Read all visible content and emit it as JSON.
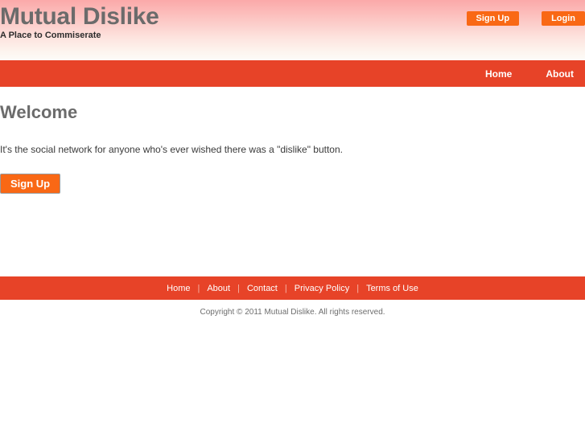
{
  "header": {
    "title": "Mutual Dislike",
    "tagline": "A Place to Commiserate",
    "signup_label": "Sign Up",
    "login_label": "Login"
  },
  "nav": {
    "items": [
      {
        "label": "Home"
      },
      {
        "label": "About"
      }
    ]
  },
  "main": {
    "heading": "Welcome",
    "paragraph": "It's the social network for anyone who's ever wished there was a \"dislike\" button.",
    "cta_label": "Sign Up"
  },
  "footer": {
    "links": [
      {
        "label": "Home"
      },
      {
        "label": "About"
      },
      {
        "label": "Contact"
      },
      {
        "label": "Privacy Policy"
      },
      {
        "label": "Terms of Use"
      }
    ],
    "separator": "|",
    "copyright": "Copyright © 2011 Mutual Dislike. All rights reserved."
  },
  "colors": {
    "brand_red": "#e74328",
    "accent_orange": "#f96815",
    "header_gradient_top": "#fba9a9",
    "header_gradient_bottom": "#fdfbf8",
    "heading_gray": "#6b6b6b"
  }
}
